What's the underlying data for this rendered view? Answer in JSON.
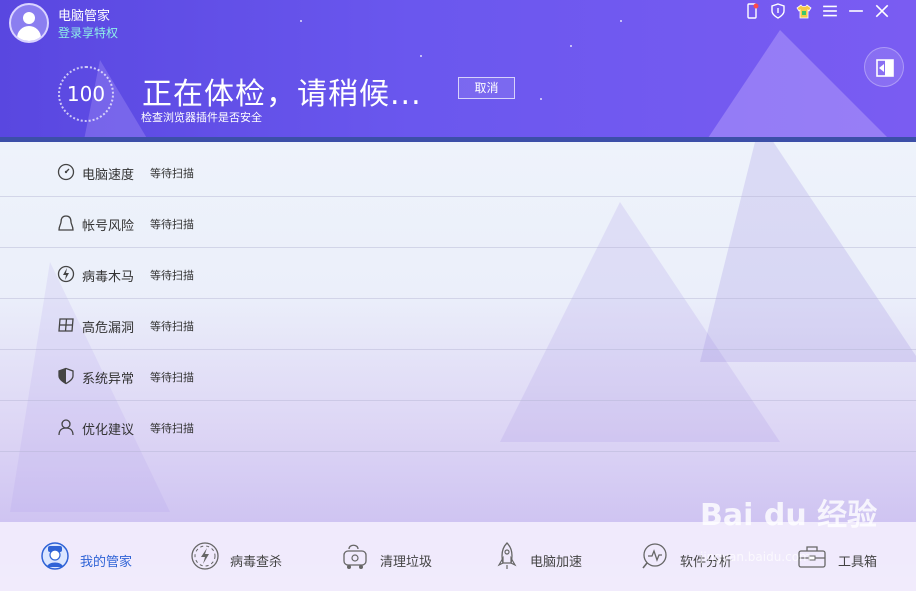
{
  "header": {
    "app_title": "电脑管家",
    "login_link": "登录享特权",
    "score": "100",
    "scan_title": "正在体检，请稍候...",
    "cancel_label": "取消",
    "scan_subtitle": "检查浏览器插件是否安全"
  },
  "scan_items": [
    {
      "label": "电脑速度",
      "status": "等待扫描",
      "icon": "speedometer-icon"
    },
    {
      "label": "帐号风险",
      "status": "等待扫描",
      "icon": "user-bubble-icon"
    },
    {
      "label": "病毒木马",
      "status": "等待扫描",
      "icon": "lightning-icon"
    },
    {
      "label": "高危漏洞",
      "status": "等待扫描",
      "icon": "window-grid-icon"
    },
    {
      "label": "系统异常",
      "status": "等待扫描",
      "icon": "shield-icon"
    },
    {
      "label": "优化建议",
      "status": "等待扫描",
      "icon": "person-icon"
    }
  ],
  "bottom_nav": [
    {
      "label": "我的管家",
      "icon": "butler-avatar-icon",
      "active": true
    },
    {
      "label": "病毒查杀",
      "icon": "virus-scan-icon",
      "active": false
    },
    {
      "label": "清理垃圾",
      "icon": "vacuum-icon",
      "active": false
    },
    {
      "label": "电脑加速",
      "icon": "rocket-icon",
      "active": false
    },
    {
      "label": "软件分析",
      "icon": "analysis-icon",
      "active": false
    },
    {
      "label": "工具箱",
      "icon": "toolbox-icon",
      "active": false
    }
  ],
  "watermark": {
    "logo": "Bai du 经验",
    "url": "jingyan.baidu.com"
  },
  "colors": {
    "accent": "#6a57ee",
    "nav_active": "#2f63d6",
    "login_link": "#8ff0e8"
  }
}
